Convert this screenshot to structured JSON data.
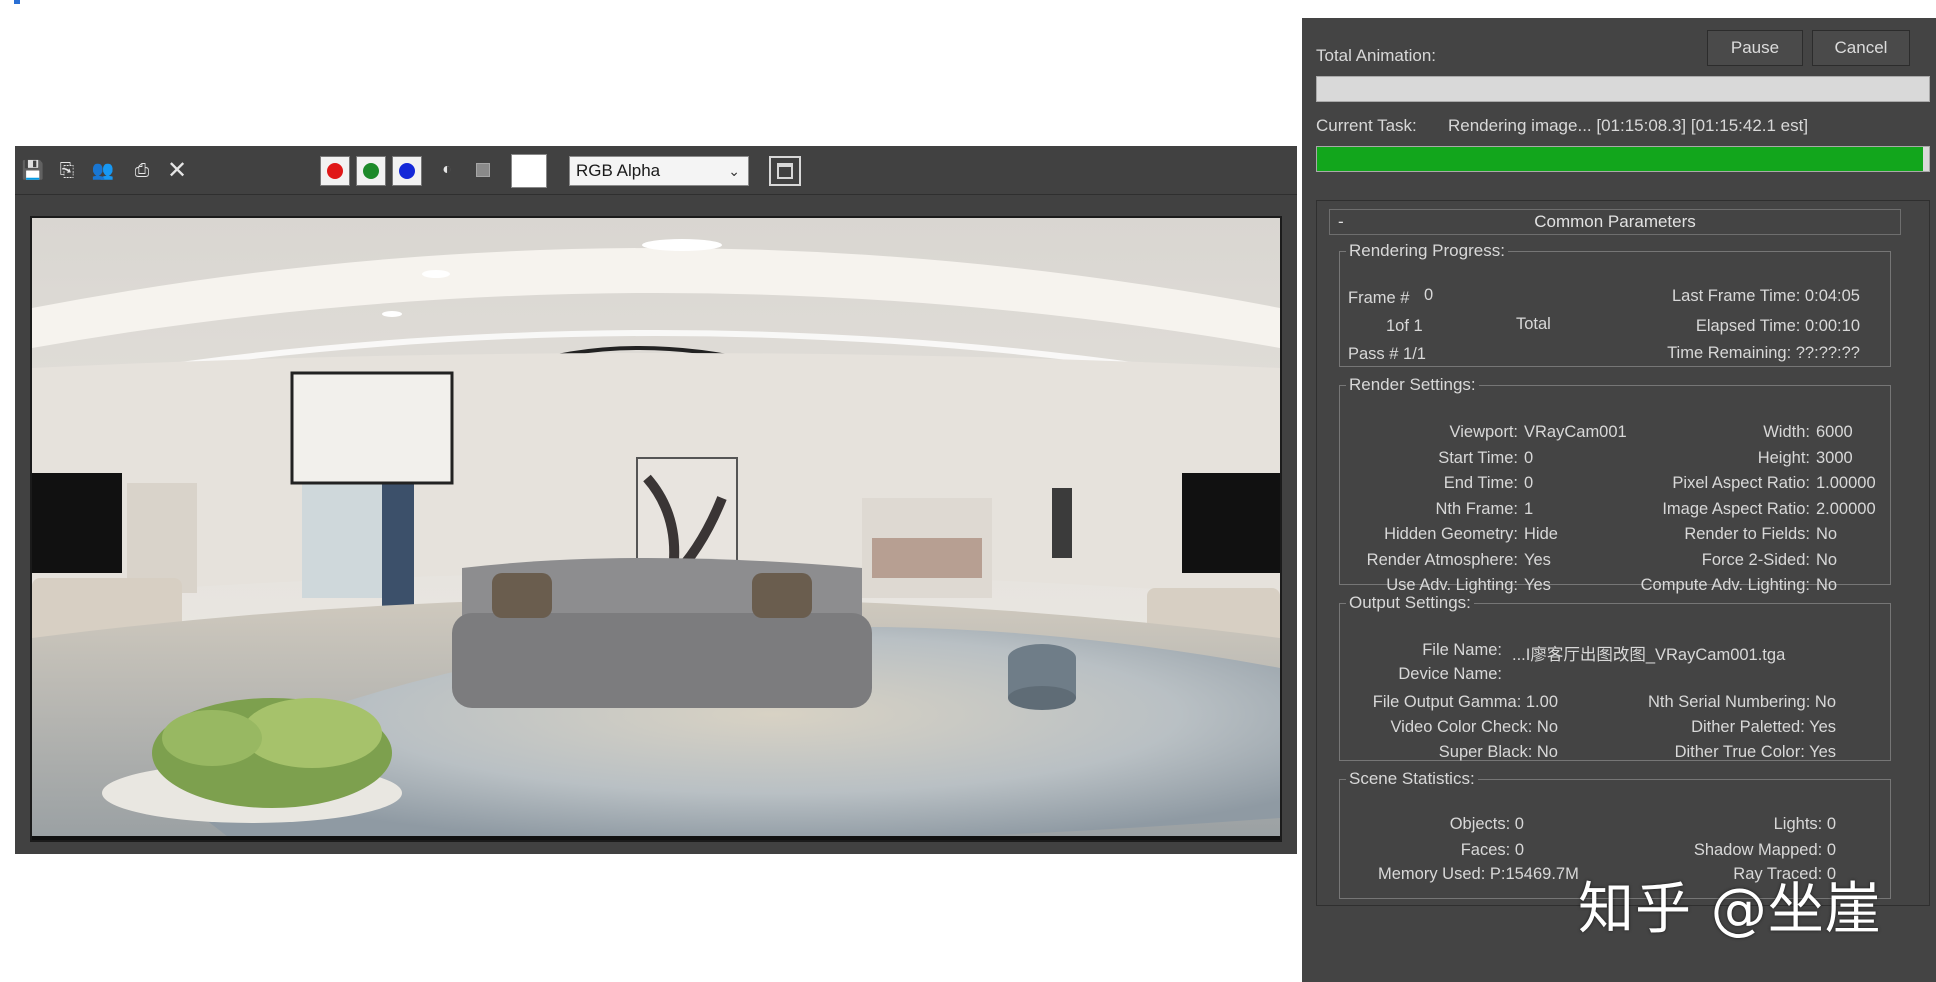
{
  "frame_buffer": {
    "toolbar": {
      "save_icon": "save-icon",
      "copy_icon": "copy-icon",
      "clone_icon": "clone-icon",
      "print_icon": "print-icon",
      "clear_icon": "clear-icon",
      "channels": [
        {
          "name": "red",
          "color": "#e01818"
        },
        {
          "name": "green",
          "color": "#1d8a2a"
        },
        {
          "name": "blue",
          "color": "#1428d8"
        }
      ],
      "channel_select": "RGB Alpha",
      "swatch_color": "#ffffff"
    },
    "viewport": {
      "description_colors": {
        "ceiling": "#e9e6e1",
        "wall": "#e4e1dc",
        "floor": "#c8c2b8",
        "rug": "#b6bcc2"
      }
    }
  },
  "render_dialog": {
    "pause_label": "Pause",
    "cancel_label": "Cancel",
    "total_animation_label": "Total Animation:",
    "total_progress": 0,
    "current_task_label": "Current Task:",
    "current_task_text": "Rendering image... [01:15:08.3] [01:15:42.1 est]",
    "task_progress": 0.99,
    "panel_title": "Common Parameters",
    "panel_collapse": "-",
    "rendering_progress": {
      "legend": "Rendering Progress:",
      "frame_label": "Frame #",
      "frame_value": "0",
      "of_text": "1of 1",
      "total_text": "Total",
      "pass_text": "Pass #  1/1",
      "last_frame_time": "Last Frame Time:  0:04:05",
      "elapsed_time": "Elapsed Time:  0:00:10",
      "time_remaining": "Time Remaining: ??:??:??"
    },
    "render_settings": {
      "legend": "Render Settings:",
      "left": [
        {
          "label": "Viewport:",
          "value": "VRayCam001"
        },
        {
          "label": "Start Time:",
          "value": "0"
        },
        {
          "label": "End Time:",
          "value": "0"
        },
        {
          "label": "Nth Frame:",
          "value": "1"
        },
        {
          "label": "Hidden Geometry:",
          "value": "Hide"
        },
        {
          "label": "Render Atmosphere:",
          "value": "Yes"
        },
        {
          "label": "Use Adv. Lighting:",
          "value": "Yes"
        }
      ],
      "right": [
        {
          "label": "Width:",
          "value": "6000"
        },
        {
          "label": "Height:",
          "value": "3000"
        },
        {
          "label": "Pixel Aspect Ratio:",
          "value": "1.00000"
        },
        {
          "label": "Image Aspect Ratio:",
          "value": "2.00000"
        },
        {
          "label": "Render to Fields:",
          "value": "No"
        },
        {
          "label": "Force 2-Sided:",
          "value": "No"
        },
        {
          "label": "Compute Adv. Lighting:",
          "value": "No"
        }
      ]
    },
    "output_settings": {
      "legend": "Output Settings:",
      "file_name_label": "File Name:",
      "file_name_value": "...I廖客厅出图改图_VRayCam001.tga",
      "device_name_label": "Device Name:",
      "rows": [
        {
          "left": "File Output Gamma:  1.00",
          "right": "Nth Serial Numbering: No"
        },
        {
          "left": "Video Color Check: No",
          "right": "Dither Paletted: Yes"
        },
        {
          "left": "Super Black: No",
          "right": "Dither True Color: Yes"
        }
      ]
    },
    "scene_statistics": {
      "legend": "Scene Statistics:",
      "objects": "Objects: 0",
      "lights": "Lights: 0",
      "faces": "Faces: 0",
      "shadow_mapped": "Shadow Mapped: 0",
      "memory_used": "Memory Used: P:15469.7M",
      "ray_traced": "Ray Traced: 0"
    }
  },
  "watermark": "知乎 @坐崖"
}
